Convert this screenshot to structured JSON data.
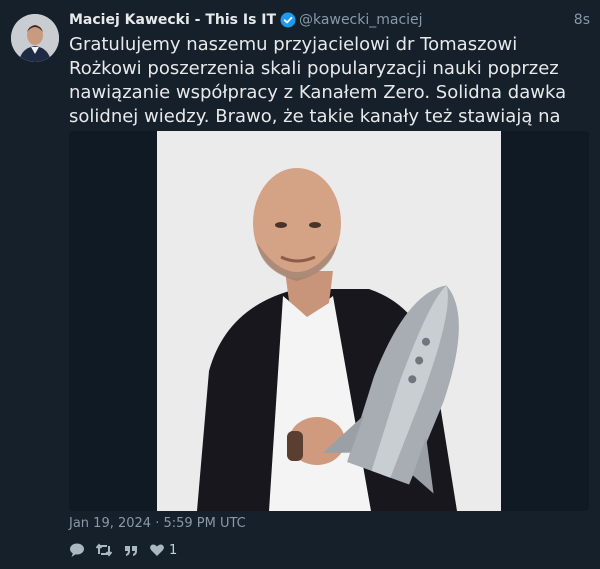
{
  "tweet": {
    "author": {
      "display_name": "Maciej Kawecki - This Is IT",
      "handle": "@kawecki_maciej",
      "verified": true
    },
    "time_ago": "8s",
    "text": "Gratulujemy naszemu przyjacielowi dr Tomaszowi Rożkowi poszerzenia skali popularyzacji nauki poprzez nawiązanie współpracy z Kanałem Zero. Solidna dawka solidnej wiedzy. Brawo, że takie kanały też stawiają na naukę!",
    "timestamp": "Jan 19, 2024 · 5:59 PM UTC",
    "stats": {
      "likes": "1"
    },
    "icons": [
      "reply-icon",
      "retweet-icon",
      "quote-icon",
      "heart-icon",
      "verified-badge-icon"
    ],
    "colors": {
      "background": "#15202b",
      "text": "#e7e9ea",
      "muted": "#8b98a5",
      "verified": "#1d9bf0"
    }
  }
}
